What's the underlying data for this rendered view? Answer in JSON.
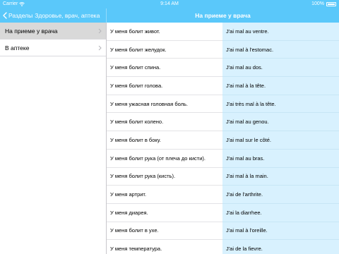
{
  "status_bar": {
    "carrier": "Carrier",
    "time": "9:14 AM",
    "battery": "100%"
  },
  "nav": {
    "back_label": "Разделы",
    "left_title": "Здоровье, врач, аптека",
    "right_title": "На приеме у врача"
  },
  "sidebar": {
    "items": [
      {
        "label": "На приеме у врача",
        "selected": true
      },
      {
        "label": "В аптеке",
        "selected": false
      }
    ]
  },
  "phrases": [
    {
      "ru": "У меня болит живот.",
      "fr": "J'ai mal au ventre."
    },
    {
      "ru": "У меня болит желудок.",
      "fr": "J'ai mal à l'estomac."
    },
    {
      "ru": "У меня болит спина.",
      "fr": "J'ai mal au dos."
    },
    {
      "ru": "У меня болит голова.",
      "fr": "J'ai mal à la tête."
    },
    {
      "ru": "У меня ужасная головная боль.",
      "fr": "J'ai très mal à la tête."
    },
    {
      "ru": "У меня болит колено.",
      "fr": "J'ai mal au genou."
    },
    {
      "ru": "У меня болит в боку.",
      "fr": "J'ai mal sur le côté."
    },
    {
      "ru": "У меня болит рука (от плеча до кисти).",
      "fr": "J'ai mal au bras."
    },
    {
      "ru": "У меня болит рука (кисть).",
      "fr": "J'ai mal à la main."
    },
    {
      "ru": "У меня артрит.",
      "fr": "J'ai de l'arthrite."
    },
    {
      "ru": "У меня диарея.",
      "fr": "J'ai la diarrhee."
    },
    {
      "ru": "У меня болит в ухе.",
      "fr": "J'ai mal à l'oreille."
    },
    {
      "ru": "У меня температура.",
      "fr": "J'ai de la fievre."
    }
  ],
  "colors": {
    "accent": "#5ac8fa",
    "selected_row": "#d9d9d9",
    "translation_bg": "#d8f1fe"
  }
}
